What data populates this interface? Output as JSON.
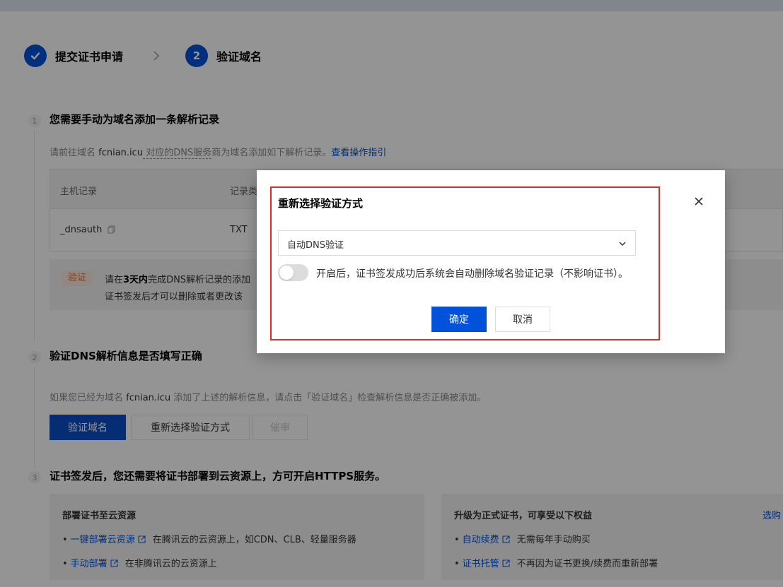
{
  "steps": [
    {
      "icon": "check-icon",
      "label": "提交证书申请"
    },
    {
      "number": "2",
      "label": "验证域名"
    }
  ],
  "section1": {
    "number": "1",
    "title": "您需要手动为域名添加一条解析记录",
    "desc_prefix": "请前往域名 ",
    "domain": "fcnian.icu",
    "desc_under": " 对应的DNS服务",
    "desc_suffix": "商为域名添加如下解析记录。",
    "guide_link": "查看操作指引",
    "table": {
      "headers": [
        "主机记录",
        "记录类"
      ],
      "row": {
        "host": "_dnsauth",
        "type": "TXT"
      }
    },
    "warning": {
      "tag": "验证",
      "line1_prefix": "请在",
      "line1_bold": "3天内",
      "line1_suffix": "完成DNS解析记录的添加",
      "line2": "证书签发后才可以删除或者更改该"
    }
  },
  "section2": {
    "number": "2",
    "title": "验证DNS解析信息是否填写正确",
    "desc_prefix": "如果您已经为域名 ",
    "domain": "fcnian.icu",
    "desc_suffix": " 添加了上述的解析信息，请点击「验证域名」检查解析信息是否正确被添加。",
    "buttons": {
      "verify": "验证域名",
      "reselect": "重新选择验证方式",
      "urge": "催审"
    }
  },
  "section3": {
    "number": "3",
    "title": "证书签发后，您还需要将证书部署到云资源上，方可开启HTTPS服务。",
    "card_left": {
      "title": "部署证书至云资源",
      "items": [
        {
          "link": "一键部署云资源",
          "text": "在腾讯云的云资源上，如CDN、CLB、轻量服务器"
        },
        {
          "link": "手动部署",
          "text": "在非腾讯云的云资源上"
        }
      ]
    },
    "card_right": {
      "title": "升级为正式证书，可享受以下权益",
      "corner_link": "选购",
      "items": [
        {
          "link": "自动续费",
          "text": "无需每年手动购买"
        },
        {
          "link": "证书托管",
          "text": "不再因为证书更换/续费而重新部署"
        }
      ]
    }
  },
  "dialog": {
    "title": "重新选择验证方式",
    "select_value": "自动DNS验证",
    "toggle_on": false,
    "toggle_text": "开启后，证书签发成功后系统会自动删除域名验证记录（不影响证书）。",
    "ok": "确定",
    "cancel": "取消"
  },
  "colors": {
    "primary": "#0052d9",
    "highlight": "#e02b2b",
    "warning": "#e37318"
  }
}
